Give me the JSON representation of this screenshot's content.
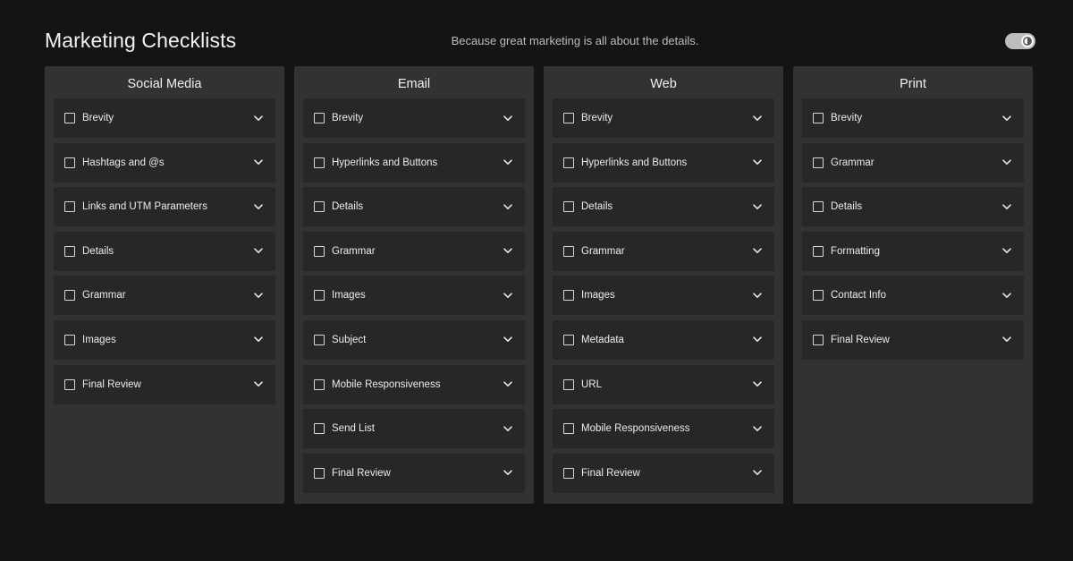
{
  "header": {
    "title": "Marketing Checklists",
    "tagline": "Because great marketing is all about the details.",
    "theme_toggle_icon": "brightness-icon"
  },
  "columns": [
    {
      "title": "Social Media",
      "items": [
        "Brevity",
        "Hashtags and @s",
        "Links and UTM Parameters",
        "Details",
        "Grammar",
        "Images",
        "Final Review"
      ]
    },
    {
      "title": "Email",
      "items": [
        "Brevity",
        "Hyperlinks and Buttons",
        "Details",
        "Grammar",
        "Images",
        "Subject",
        "Mobile Responsiveness",
        "Send List",
        "Final Review"
      ]
    },
    {
      "title": "Web",
      "items": [
        "Brevity",
        "Hyperlinks and Buttons",
        "Details",
        "Grammar",
        "Images",
        "Metadata",
        "URL",
        "Mobile Responsiveness",
        "Final Review"
      ]
    },
    {
      "title": "Print",
      "items": [
        "Brevity",
        "Grammar",
        "Details",
        "Formatting",
        "Contact Info",
        "Final Review"
      ]
    }
  ],
  "colors": {
    "background": "#141414",
    "column": "#323232",
    "item": "#272727",
    "text": "#ececec"
  }
}
